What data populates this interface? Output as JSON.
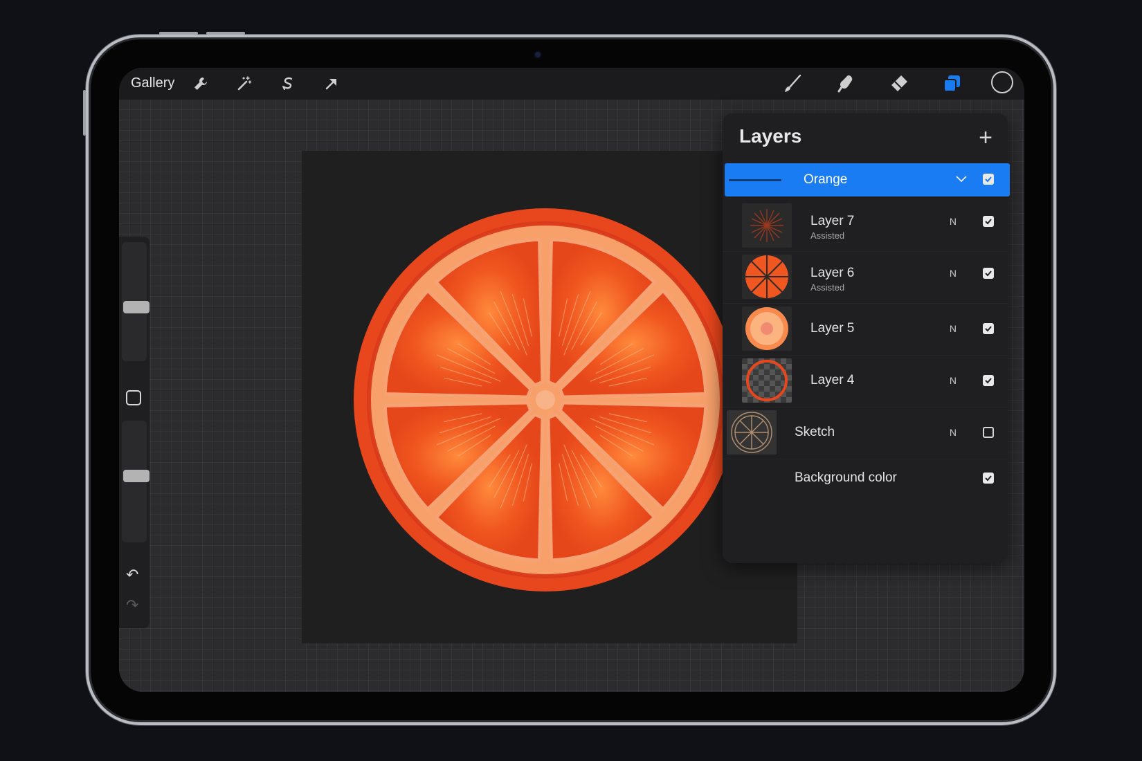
{
  "toolbar": {
    "gallery_label": "Gallery",
    "left_tools": [
      "wrench-icon",
      "magic-wand-icon",
      "selection-icon",
      "transform-arrow-icon"
    ],
    "right_tools": [
      "brush-icon",
      "smudge-icon",
      "eraser-icon",
      "layers-icon"
    ],
    "active_tool": "layers-icon",
    "accent_color": "#1a7cf2",
    "current_color": "#1b1b1d"
  },
  "layers_panel": {
    "title": "Layers",
    "add_symbol": "+",
    "group": {
      "name": "Orange",
      "visible": true
    },
    "layers": [
      {
        "name": "Layer 7",
        "sub": "Assisted",
        "blend": "N",
        "visible": true
      },
      {
        "name": "Layer 6",
        "sub": "Assisted",
        "blend": "N",
        "visible": true
      },
      {
        "name": "Layer 5",
        "sub": "",
        "blend": "N",
        "visible": true
      },
      {
        "name": "Layer 4",
        "sub": "",
        "blend": "N",
        "visible": true
      },
      {
        "name": "Sketch",
        "sub": "",
        "blend": "N",
        "visible": false
      },
      {
        "name": "Background color",
        "sub": "",
        "blend": "",
        "visible": true
      }
    ]
  },
  "sidebar": {
    "brush_size_level": 0.45,
    "opacity_level": 0.55,
    "undo_symbol": "↶",
    "redo_symbol": "↷"
  },
  "colors": {
    "rind": "#e8461c",
    "pith": "#f7b07a",
    "segment": "#f0561f",
    "canvas": "#1f1f1f"
  }
}
